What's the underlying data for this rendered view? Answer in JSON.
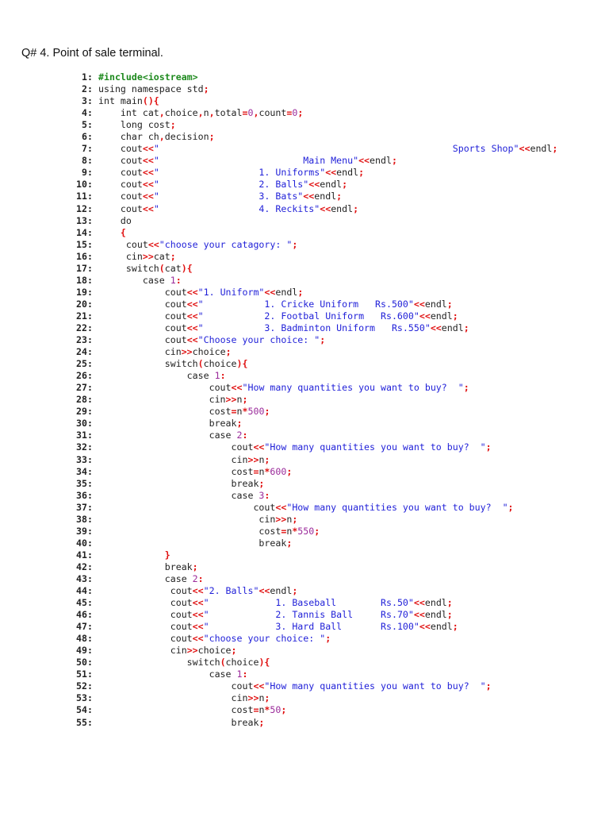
{
  "title": "Q# 4. Point of sale terminal.",
  "colors": {
    "operator": "#e01010",
    "string": "#1f1fd8",
    "number": "#9a2a9a",
    "directive": "#1e8a1e"
  },
  "code": {
    "lines": [
      {
        "n": "1:",
        "t": [
          [
            "d",
            "#include<iostream>"
          ]
        ]
      },
      {
        "n": "2:",
        "t": [
          [
            "p",
            "using namespace std"
          ],
          [
            "o",
            ";"
          ]
        ]
      },
      {
        "n": "3:",
        "t": [
          [
            "p",
            "int main"
          ],
          [
            "o",
            "(){"
          ]
        ]
      },
      {
        "n": "4:",
        "t": [
          [
            "p",
            "    int cat"
          ],
          [
            "o",
            ","
          ],
          [
            "p",
            "choice"
          ],
          [
            "o",
            ","
          ],
          [
            "p",
            "n"
          ],
          [
            "o",
            ","
          ],
          [
            "p",
            "total"
          ],
          [
            "o",
            "="
          ],
          [
            "n",
            "0"
          ],
          [
            "o",
            ","
          ],
          [
            "p",
            "count"
          ],
          [
            "o",
            "="
          ],
          [
            "n",
            "0"
          ],
          [
            "o",
            ";"
          ]
        ]
      },
      {
        "n": "5:",
        "t": [
          [
            "p",
            "    long cost"
          ],
          [
            "o",
            ";"
          ]
        ]
      },
      {
        "n": "6:",
        "t": [
          [
            "p",
            "    char ch"
          ],
          [
            "o",
            ","
          ],
          [
            "p",
            "decision"
          ],
          [
            "o",
            ";"
          ]
        ]
      },
      {
        "n": "7:",
        "t": [
          [
            "p",
            "    cout"
          ],
          [
            "o",
            "<<"
          ],
          [
            "s",
            "\"                                                     Sports Shop\""
          ],
          [
            "o",
            "<<"
          ],
          [
            "p",
            "endl"
          ],
          [
            "o",
            ";"
          ]
        ]
      },
      {
        "n": "8:",
        "t": [
          [
            "p",
            "    cout"
          ],
          [
            "o",
            "<<"
          ],
          [
            "s",
            "\"                          Main Menu\""
          ],
          [
            "o",
            "<<"
          ],
          [
            "p",
            "endl"
          ],
          [
            "o",
            ";"
          ]
        ]
      },
      {
        "n": "9:",
        "t": [
          [
            "p",
            "    cout"
          ],
          [
            "o",
            "<<"
          ],
          [
            "s",
            "\"                  1. Uniforms\""
          ],
          [
            "o",
            "<<"
          ],
          [
            "p",
            "endl"
          ],
          [
            "o",
            ";"
          ]
        ]
      },
      {
        "n": "10:",
        "t": [
          [
            "p",
            "    cout"
          ],
          [
            "o",
            "<<"
          ],
          [
            "s",
            "\"                  2. Balls\""
          ],
          [
            "o",
            "<<"
          ],
          [
            "p",
            "endl"
          ],
          [
            "o",
            ";"
          ]
        ]
      },
      {
        "n": "11:",
        "t": [
          [
            "p",
            "    cout"
          ],
          [
            "o",
            "<<"
          ],
          [
            "s",
            "\"                  3. Bats\""
          ],
          [
            "o",
            "<<"
          ],
          [
            "p",
            "endl"
          ],
          [
            "o",
            ";"
          ]
        ]
      },
      {
        "n": "12:",
        "t": [
          [
            "p",
            "    cout"
          ],
          [
            "o",
            "<<"
          ],
          [
            "s",
            "\"                  4. Reckits\""
          ],
          [
            "o",
            "<<"
          ],
          [
            "p",
            "endl"
          ],
          [
            "o",
            ";"
          ]
        ]
      },
      {
        "n": "13:",
        "t": [
          [
            "p",
            "    do"
          ]
        ]
      },
      {
        "n": "14:",
        "t": [
          [
            "o",
            "    {"
          ]
        ]
      },
      {
        "n": "15:",
        "t": [
          [
            "p",
            "     cout"
          ],
          [
            "o",
            "<<"
          ],
          [
            "s",
            "\"choose your catagory: \""
          ],
          [
            "o",
            ";"
          ]
        ]
      },
      {
        "n": "16:",
        "t": [
          [
            "p",
            "     cin"
          ],
          [
            "o",
            ">>"
          ],
          [
            "p",
            "cat"
          ],
          [
            "o",
            ";"
          ]
        ]
      },
      {
        "n": "17:",
        "t": [
          [
            "p",
            "     switch"
          ],
          [
            "o",
            "("
          ],
          [
            "p",
            "cat"
          ],
          [
            "o",
            "){"
          ]
        ]
      },
      {
        "n": "18:",
        "t": [
          [
            "p",
            "        case "
          ],
          [
            "n",
            "1"
          ],
          [
            "o",
            ":"
          ]
        ]
      },
      {
        "n": "19:",
        "t": [
          [
            "p",
            "            cout"
          ],
          [
            "o",
            "<<"
          ],
          [
            "s",
            "\"1. Uniform\""
          ],
          [
            "o",
            "<<"
          ],
          [
            "p",
            "endl"
          ],
          [
            "o",
            ";"
          ]
        ]
      },
      {
        "n": "20:",
        "t": [
          [
            "p",
            "            cout"
          ],
          [
            "o",
            "<<"
          ],
          [
            "s",
            "\"           1. Cricke Uniform   Rs.500\""
          ],
          [
            "o",
            "<<"
          ],
          [
            "p",
            "endl"
          ],
          [
            "o",
            ";"
          ]
        ]
      },
      {
        "n": "21:",
        "t": [
          [
            "p",
            "            cout"
          ],
          [
            "o",
            "<<"
          ],
          [
            "s",
            "\"           2. Footbal Uniform   Rs.600\""
          ],
          [
            "o",
            "<<"
          ],
          [
            "p",
            "endl"
          ],
          [
            "o",
            ";"
          ]
        ]
      },
      {
        "n": "22:",
        "t": [
          [
            "p",
            "            cout"
          ],
          [
            "o",
            "<<"
          ],
          [
            "s",
            "\"           3. Badminton Uniform   Rs.550\""
          ],
          [
            "o",
            "<<"
          ],
          [
            "p",
            "endl"
          ],
          [
            "o",
            ";"
          ]
        ]
      },
      {
        "n": "23:",
        "t": [
          [
            "p",
            "            cout"
          ],
          [
            "o",
            "<<"
          ],
          [
            "s",
            "\"Choose your choice: \""
          ],
          [
            "o",
            ";"
          ]
        ]
      },
      {
        "n": "24:",
        "t": [
          [
            "p",
            "            cin"
          ],
          [
            "o",
            ">>"
          ],
          [
            "p",
            "choice"
          ],
          [
            "o",
            ";"
          ]
        ]
      },
      {
        "n": "25:",
        "t": [
          [
            "p",
            "            switch"
          ],
          [
            "o",
            "("
          ],
          [
            "p",
            "choice"
          ],
          [
            "o",
            "){"
          ]
        ]
      },
      {
        "n": "26:",
        "t": [
          [
            "p",
            "                case "
          ],
          [
            "n",
            "1"
          ],
          [
            "o",
            ":"
          ]
        ]
      },
      {
        "n": "27:",
        "t": [
          [
            "p",
            "                    cout"
          ],
          [
            "o",
            "<<"
          ],
          [
            "s",
            "\"How many quantities you want to buy?  \""
          ],
          [
            "o",
            ";"
          ]
        ]
      },
      {
        "n": "28:",
        "t": [
          [
            "p",
            "                    cin"
          ],
          [
            "o",
            ">>"
          ],
          [
            "p",
            "n"
          ],
          [
            "o",
            ";"
          ]
        ]
      },
      {
        "n": "29:",
        "t": [
          [
            "p",
            "                    cost"
          ],
          [
            "o",
            "="
          ],
          [
            "p",
            "n"
          ],
          [
            "o",
            "*"
          ],
          [
            "n",
            "500"
          ],
          [
            "o",
            ";"
          ]
        ]
      },
      {
        "n": "30:",
        "t": [
          [
            "p",
            "                    break"
          ],
          [
            "o",
            ";"
          ]
        ]
      },
      {
        "n": "31:",
        "t": [
          [
            "p",
            "                    case "
          ],
          [
            "n",
            "2"
          ],
          [
            "o",
            ":"
          ]
        ]
      },
      {
        "n": "32:",
        "t": [
          [
            "p",
            "                        cout"
          ],
          [
            "o",
            "<<"
          ],
          [
            "s",
            "\"How many quantities you want to buy?  \""
          ],
          [
            "o",
            ";"
          ]
        ]
      },
      {
        "n": "33:",
        "t": [
          [
            "p",
            "                        cin"
          ],
          [
            "o",
            ">>"
          ],
          [
            "p",
            "n"
          ],
          [
            "o",
            ";"
          ]
        ]
      },
      {
        "n": "34:",
        "t": [
          [
            "p",
            "                        cost"
          ],
          [
            "o",
            "="
          ],
          [
            "p",
            "n"
          ],
          [
            "o",
            "*"
          ],
          [
            "n",
            "600"
          ],
          [
            "o",
            ";"
          ]
        ]
      },
      {
        "n": "35:",
        "t": [
          [
            "p",
            "                        break"
          ],
          [
            "o",
            ";"
          ]
        ]
      },
      {
        "n": "36:",
        "t": [
          [
            "p",
            "                        case "
          ],
          [
            "n",
            "3"
          ],
          [
            "o",
            ":"
          ]
        ]
      },
      {
        "n": "37:",
        "t": [
          [
            "p",
            "                            cout"
          ],
          [
            "o",
            "<<"
          ],
          [
            "s",
            "\"How many quantities you want to buy?  \""
          ],
          [
            "o",
            ";"
          ]
        ]
      },
      {
        "n": "38:",
        "t": [
          [
            "p",
            "                             cin"
          ],
          [
            "o",
            ">>"
          ],
          [
            "p",
            "n"
          ],
          [
            "o",
            ";"
          ]
        ]
      },
      {
        "n": "39:",
        "t": [
          [
            "p",
            "                             cost"
          ],
          [
            "o",
            "="
          ],
          [
            "p",
            "n"
          ],
          [
            "o",
            "*"
          ],
          [
            "n",
            "550"
          ],
          [
            "o",
            ";"
          ]
        ]
      },
      {
        "n": "40:",
        "t": [
          [
            "p",
            "                             break"
          ],
          [
            "o",
            ";"
          ]
        ]
      },
      {
        "n": "41:",
        "t": [
          [
            "o",
            "            }"
          ]
        ]
      },
      {
        "n": "42:",
        "t": [
          [
            "p",
            "            break"
          ],
          [
            "o",
            ";"
          ]
        ]
      },
      {
        "n": "43:",
        "t": [
          [
            "p",
            "            case "
          ],
          [
            "n",
            "2"
          ],
          [
            "o",
            ":"
          ]
        ]
      },
      {
        "n": "44:",
        "t": [
          [
            "p",
            "             cout"
          ],
          [
            "o",
            "<<"
          ],
          [
            "s",
            "\"2. Balls\""
          ],
          [
            "o",
            "<<"
          ],
          [
            "p",
            "endl"
          ],
          [
            "o",
            ";"
          ]
        ]
      },
      {
        "n": "45:",
        "t": [
          [
            "p",
            "             cout"
          ],
          [
            "o",
            "<<"
          ],
          [
            "s",
            "\"            1. Baseball        Rs.50\""
          ],
          [
            "o",
            "<<"
          ],
          [
            "p",
            "endl"
          ],
          [
            "o",
            ";"
          ]
        ]
      },
      {
        "n": "46:",
        "t": [
          [
            "p",
            "             cout"
          ],
          [
            "o",
            "<<"
          ],
          [
            "s",
            "\"            2. Tannis Ball     Rs.70\""
          ],
          [
            "o",
            "<<"
          ],
          [
            "p",
            "endl"
          ],
          [
            "o",
            ";"
          ]
        ]
      },
      {
        "n": "47:",
        "t": [
          [
            "p",
            "             cout"
          ],
          [
            "o",
            "<<"
          ],
          [
            "s",
            "\"            3. Hard Ball       Rs.100\""
          ],
          [
            "o",
            "<<"
          ],
          [
            "p",
            "endl"
          ],
          [
            "o",
            ";"
          ]
        ]
      },
      {
        "n": "48:",
        "t": [
          [
            "p",
            "             cout"
          ],
          [
            "o",
            "<<"
          ],
          [
            "s",
            "\"choose your choice: \""
          ],
          [
            "o",
            ";"
          ]
        ]
      },
      {
        "n": "49:",
        "t": [
          [
            "p",
            "             cin"
          ],
          [
            "o",
            ">>"
          ],
          [
            "p",
            "choice"
          ],
          [
            "o",
            ";"
          ]
        ]
      },
      {
        "n": "50:",
        "t": [
          [
            "p",
            "                switch"
          ],
          [
            "o",
            "("
          ],
          [
            "p",
            "choice"
          ],
          [
            "o",
            "){"
          ]
        ]
      },
      {
        "n": "51:",
        "t": [
          [
            "p",
            "                    case "
          ],
          [
            "n",
            "1"
          ],
          [
            "o",
            ":"
          ]
        ]
      },
      {
        "n": "52:",
        "t": [
          [
            "p",
            "                        cout"
          ],
          [
            "o",
            "<<"
          ],
          [
            "s",
            "\"How many quantities you want to buy?  \""
          ],
          [
            "o",
            ";"
          ]
        ]
      },
      {
        "n": "53:",
        "t": [
          [
            "p",
            "                        cin"
          ],
          [
            "o",
            ">>"
          ],
          [
            "p",
            "n"
          ],
          [
            "o",
            ";"
          ]
        ]
      },
      {
        "n": "54:",
        "t": [
          [
            "p",
            "                        cost"
          ],
          [
            "o",
            "="
          ],
          [
            "p",
            "n"
          ],
          [
            "o",
            "*"
          ],
          [
            "n",
            "50"
          ],
          [
            "o",
            ";"
          ]
        ]
      },
      {
        "n": "55:",
        "t": [
          [
            "p",
            "                        break"
          ],
          [
            "o",
            ";"
          ]
        ]
      }
    ]
  }
}
